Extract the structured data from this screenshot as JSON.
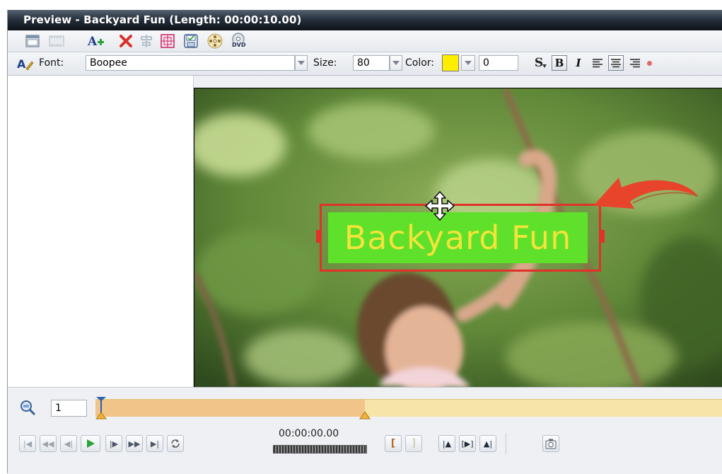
{
  "window": {
    "title": "Preview - Backyard Fun (Length: 00:00:10.00)"
  },
  "toolbar": {
    "icons": [
      "view-icon",
      "filmstrip-icon",
      "add-text-icon",
      "delete-icon",
      "align-icon",
      "safe-area-icon",
      "save-icon",
      "disc-menu-icon",
      "dvd-icon"
    ],
    "dvd_label": "DVD"
  },
  "text_format": {
    "font_label": "Font:",
    "font_value": "Boopee",
    "size_label": "Size:",
    "size_value": "80",
    "color_label": "Color:",
    "color_swatch": "#ffee00",
    "opacity_value": "0",
    "bold_label": "B",
    "italic_label": "I",
    "shadow_label": "S"
  },
  "preview": {
    "caption_text": "Backyard Fun",
    "caption_color": "#f2e43a",
    "caption_bg": "#5fe02a",
    "selection_color": "#e0312a",
    "arrow_color": "#e8432b"
  },
  "timeline": {
    "zoom_value": "1",
    "progress_fraction": 0.0,
    "selection_end_fraction": 0.43
  },
  "playback": {
    "timecode": "00:00:00.00"
  }
}
